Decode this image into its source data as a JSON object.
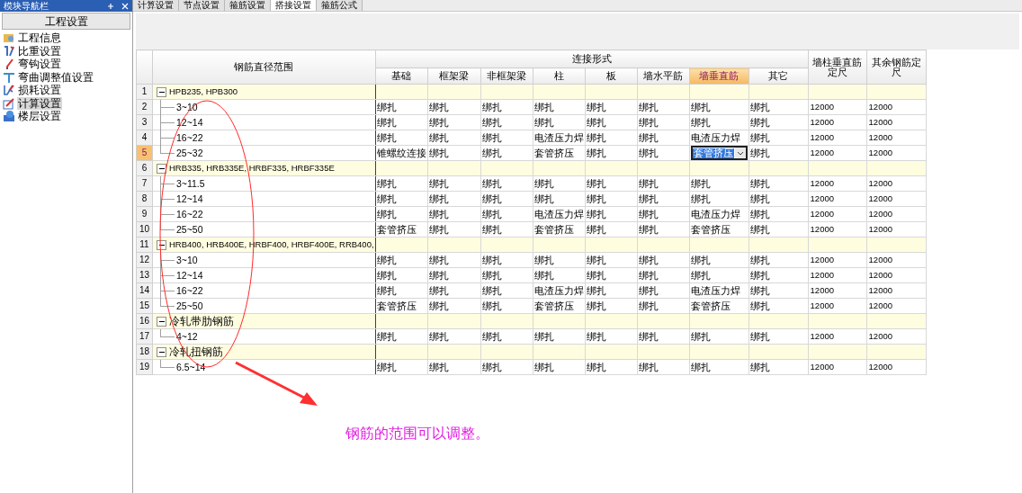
{
  "sidebar": {
    "panel_title": "模块导航栏",
    "header": "工程设置",
    "items": [
      {
        "label": "工程信息",
        "kind": "info",
        "selected": false
      },
      {
        "label": "比重设置",
        "kind": "weight",
        "selected": false
      },
      {
        "label": "弯钩设置",
        "kind": "hook",
        "selected": false
      },
      {
        "label": "弯曲调整值设置",
        "kind": "bend",
        "selected": false
      },
      {
        "label": "损耗设置",
        "kind": "loss",
        "selected": false
      },
      {
        "label": "计算设置",
        "kind": "calc",
        "selected": true
      },
      {
        "label": "楼层设置",
        "kind": "floor",
        "selected": false
      }
    ]
  },
  "tabs": [
    {
      "label": "计算设置",
      "selected": false
    },
    {
      "label": "节点设置",
      "selected": false
    },
    {
      "label": "箍筋设置",
      "selected": false
    },
    {
      "label": "搭接设置",
      "selected": true
    },
    {
      "label": "箍筋公式",
      "selected": false
    }
  ],
  "table": {
    "range_header": "钢筋直径范围",
    "group_header": "连接形式",
    "columns": [
      {
        "label": "基础",
        "selected": false
      },
      {
        "label": "框架梁",
        "selected": false
      },
      {
        "label": "非框架梁",
        "selected": false
      },
      {
        "label": "柱",
        "selected": false
      },
      {
        "label": "板",
        "selected": false
      },
      {
        "label": "墙水平筋",
        "selected": false
      },
      {
        "label": "墙垂直筋",
        "selected": true
      },
      {
        "label": "其它",
        "selected": false
      }
    ],
    "length_columns": [
      "墙柱垂直筋定尺",
      "其余钢筋定尺"
    ],
    "rows": [
      {
        "number": "1",
        "kind": "group",
        "label": "HPB235, HPB300",
        "expanded": true,
        "selected": false
      },
      {
        "number": "2",
        "kind": "item",
        "label": "3~10",
        "selected": false,
        "connections": [
          "绑扎",
          "绑扎",
          "绑扎",
          "绑扎",
          "绑扎",
          "绑扎",
          "绑扎",
          "绑扎"
        ],
        "lengths": [
          "12000",
          "12000"
        ]
      },
      {
        "number": "3",
        "kind": "item",
        "label": "12~14",
        "selected": false,
        "connections": [
          "绑扎",
          "绑扎",
          "绑扎",
          "绑扎",
          "绑扎",
          "绑扎",
          "绑扎",
          "绑扎"
        ],
        "lengths": [
          "12000",
          "12000"
        ]
      },
      {
        "number": "4",
        "kind": "item",
        "label": "16~22",
        "selected": false,
        "connections": [
          "绑扎",
          "绑扎",
          "绑扎",
          "电渣压力焊",
          "绑扎",
          "绑扎",
          "电渣压力焊",
          "绑扎"
        ],
        "lengths": [
          "12000",
          "12000"
        ]
      },
      {
        "number": "5",
        "kind": "item",
        "label": "25~32",
        "selected": true,
        "connections": [
          "锥螺纹连接",
          "绑扎",
          "绑扎",
          "套管挤压",
          "绑扎",
          "绑扎",
          "套管挤压",
          "绑扎"
        ],
        "lengths": [
          "12000",
          "12000"
        ]
      },
      {
        "number": "6",
        "kind": "group",
        "label": "HRB335, HRB335E, HRBF335, HRBF335E",
        "expanded": true,
        "selected": false
      },
      {
        "number": "7",
        "kind": "item",
        "label": "3~11.5",
        "selected": false,
        "connections": [
          "绑扎",
          "绑扎",
          "绑扎",
          "绑扎",
          "绑扎",
          "绑扎",
          "绑扎",
          "绑扎"
        ],
        "lengths": [
          "12000",
          "12000"
        ]
      },
      {
        "number": "8",
        "kind": "item",
        "label": "12~14",
        "selected": false,
        "connections": [
          "绑扎",
          "绑扎",
          "绑扎",
          "绑扎",
          "绑扎",
          "绑扎",
          "绑扎",
          "绑扎"
        ],
        "lengths": [
          "12000",
          "12000"
        ]
      },
      {
        "number": "9",
        "kind": "item",
        "label": "16~22",
        "selected": false,
        "connections": [
          "绑扎",
          "绑扎",
          "绑扎",
          "电渣压力焊",
          "绑扎",
          "绑扎",
          "电渣压力焊",
          "绑扎"
        ],
        "lengths": [
          "12000",
          "12000"
        ]
      },
      {
        "number": "10",
        "kind": "item",
        "label": "25~50",
        "selected": false,
        "connections": [
          "套管挤压",
          "绑扎",
          "绑扎",
          "套管挤压",
          "绑扎",
          "绑扎",
          "套管挤压",
          "绑扎"
        ],
        "lengths": [
          "12000",
          "12000"
        ]
      },
      {
        "number": "11",
        "kind": "group",
        "label": "HRB400, HRB400E, HRBF400, HRBF400E, RRB400,",
        "expanded": true,
        "selected": false
      },
      {
        "number": "12",
        "kind": "item",
        "label": "3~10",
        "selected": false,
        "connections": [
          "绑扎",
          "绑扎",
          "绑扎",
          "绑扎",
          "绑扎",
          "绑扎",
          "绑扎",
          "绑扎"
        ],
        "lengths": [
          "12000",
          "12000"
        ]
      },
      {
        "number": "13",
        "kind": "item",
        "label": "12~14",
        "selected": false,
        "connections": [
          "绑扎",
          "绑扎",
          "绑扎",
          "绑扎",
          "绑扎",
          "绑扎",
          "绑扎",
          "绑扎"
        ],
        "lengths": [
          "12000",
          "12000"
        ]
      },
      {
        "number": "14",
        "kind": "item",
        "label": "16~22",
        "selected": false,
        "connections": [
          "绑扎",
          "绑扎",
          "绑扎",
          "电渣压力焊",
          "绑扎",
          "绑扎",
          "电渣压力焊",
          "绑扎"
        ],
        "lengths": [
          "12000",
          "12000"
        ]
      },
      {
        "number": "15",
        "kind": "item",
        "label": "25~50",
        "selected": false,
        "connections": [
          "套管挤压",
          "绑扎",
          "绑扎",
          "套管挤压",
          "绑扎",
          "绑扎",
          "套管挤压",
          "绑扎"
        ],
        "lengths": [
          "12000",
          "12000"
        ]
      },
      {
        "number": "16",
        "kind": "group",
        "label": "冷轧带肋钢筋",
        "expanded": true,
        "selected": false
      },
      {
        "number": "17",
        "kind": "item",
        "label": "4~12",
        "selected": false,
        "connections": [
          "绑扎",
          "绑扎",
          "绑扎",
          "绑扎",
          "绑扎",
          "绑扎",
          "绑扎",
          "绑扎"
        ],
        "lengths": [
          "12000",
          "12000"
        ]
      },
      {
        "number": "18",
        "kind": "group",
        "label": "冷轧扭钢筋",
        "expanded": true,
        "selected": false
      },
      {
        "number": "19",
        "kind": "item",
        "label": "6.5~14",
        "selected": false,
        "connections": [
          "绑扎",
          "绑扎",
          "绑扎",
          "绑扎",
          "绑扎",
          "绑扎",
          "绑扎",
          "绑扎"
        ],
        "lengths": [
          "12000",
          "12000"
        ]
      }
    ]
  },
  "annotation": {
    "note": "钢筋的范围可以调整。"
  }
}
